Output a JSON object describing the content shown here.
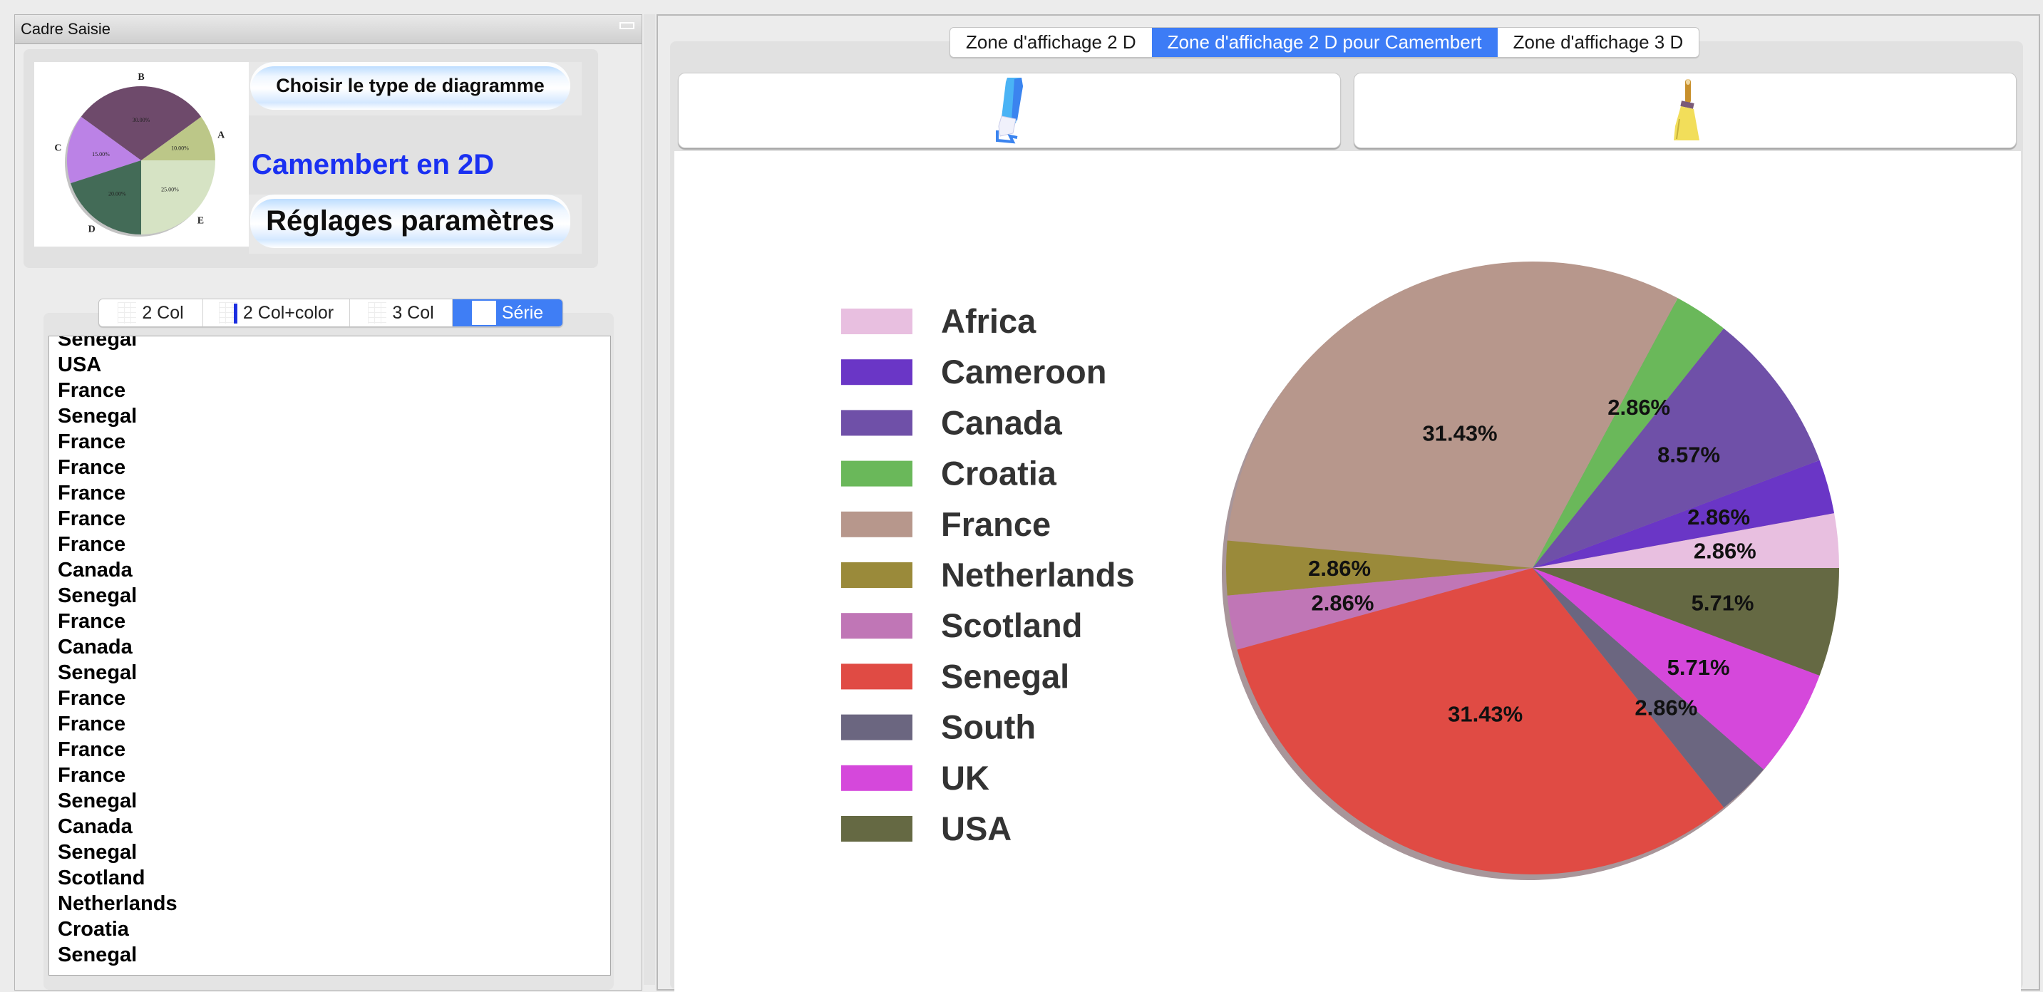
{
  "left_panel": {
    "title": "Cadre Saisie",
    "choose_button_label": "Choisir le type de diagramme",
    "chart_type_label": "Camembert en 2D",
    "settings_button_label": "Réglages paramètres",
    "thumbnail": {
      "slices": [
        {
          "label": "A",
          "percent_label": "10.00%",
          "value": 10,
          "color": "#bcc788"
        },
        {
          "label": "B",
          "percent_label": "30.00%",
          "value": 30,
          "color": "#6e4a6b"
        },
        {
          "label": "C",
          "percent_label": "15.00%",
          "value": 15,
          "color": "#bb82e6"
        },
        {
          "label": "D",
          "percent_label": "20.00%",
          "value": 20,
          "color": "#436b57"
        },
        {
          "label": "E",
          "percent_label": "25.00%",
          "value": 25,
          "color": "#d6e3c4"
        }
      ]
    },
    "input_modes": [
      {
        "label": "2 Col",
        "icon": "grid-icon",
        "active": false
      },
      {
        "label": "2 Col+color",
        "icon": "grid-color-icon",
        "active": false
      },
      {
        "label": "3 Col",
        "icon": "grid-icon",
        "active": false
      },
      {
        "label": "Série",
        "icon": "blank-icon",
        "active": true
      }
    ],
    "series_values": [
      "Senegal",
      "USA",
      "France",
      "Senegal",
      "France",
      "France",
      "France",
      "France",
      "France",
      "Canada",
      "Senegal",
      "France",
      "Canada",
      "Senegal",
      "France",
      "France",
      "France",
      "France",
      "Senegal",
      "Canada",
      "Senegal",
      "Scotland",
      "Netherlands",
      "Croatia",
      "Senegal"
    ]
  },
  "right_panel": {
    "tabs": [
      {
        "label": "Zone d'affichage 2 D",
        "active": false
      },
      {
        "label": "Zone d'affichage 2 D pour Camembert",
        "active": true
      },
      {
        "label": "Zone d'affichage 3 D",
        "active": false
      }
    ],
    "tool_buttons": [
      {
        "name": "edit",
        "icon": "pencil-eraser-icon"
      },
      {
        "name": "clear",
        "icon": "broom-icon"
      }
    ]
  },
  "colors": {
    "accent": "#3d7cf6",
    "chart_type_label": "#1a30f2"
  },
  "chart_data": {
    "type": "pie",
    "title": "",
    "start_angle_deg": 0,
    "direction": "counterclockwise",
    "legend_position": "left",
    "categories": [
      "Africa",
      "Cameroon",
      "Canada",
      "Croatia",
      "France",
      "Netherlands",
      "Scotland",
      "Senegal",
      "South",
      "UK",
      "USA"
    ],
    "values": [
      2.86,
      2.86,
      8.57,
      2.86,
      31.43,
      2.86,
      2.86,
      31.43,
      2.86,
      5.71,
      5.71
    ],
    "labels": [
      "2.86%",
      "2.86%",
      "8.57%",
      "2.86%",
      "31.43%",
      "2.86%",
      "2.86%",
      "31.43%",
      "2.86%",
      "5.71%",
      "5.71%"
    ],
    "colors": [
      "#e8bfe0",
      "#6a36c6",
      "#6f50a8",
      "#6ab85a",
      "#b7978c",
      "#9a8a3a",
      "#c076b6",
      "#e04b44",
      "#6b6680",
      "#d548db",
      "#656943"
    ]
  }
}
